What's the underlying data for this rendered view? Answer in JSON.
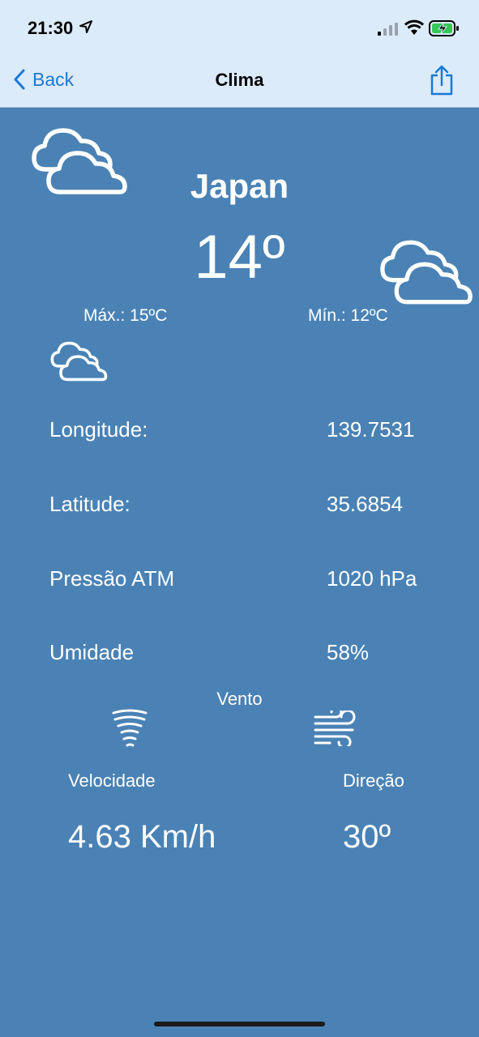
{
  "status_bar": {
    "time": "21:30",
    "icons": [
      "location-arrow-icon",
      "cellular-signal-icon",
      "wifi-icon",
      "battery-charging-icon"
    ]
  },
  "nav": {
    "back_label": "Back",
    "title": "Clima",
    "share_icon": "share-icon"
  },
  "weather": {
    "country": "Japan",
    "temperature": "14º",
    "max": "Máx.: 15ºC",
    "min": "Mín.: 12ºC",
    "details": [
      {
        "label": "Longitude:",
        "value": "139.7531"
      },
      {
        "label": "Latitude:",
        "value": "35.6854"
      },
      {
        "label": "Pressão ATM",
        "value": "1020 hPa"
      },
      {
        "label": "Umidade",
        "value": "58%"
      }
    ],
    "wind": {
      "title": "Vento",
      "speed_label": "Velocidade",
      "speed_value": "4.63 Km/h",
      "direction_label": "Direção",
      "direction_value": "30º"
    }
  },
  "colors": {
    "background": "#4a82b5",
    "bar_background": "#dcebf9",
    "accent": "#1a78d6",
    "text": "#ffffff"
  }
}
